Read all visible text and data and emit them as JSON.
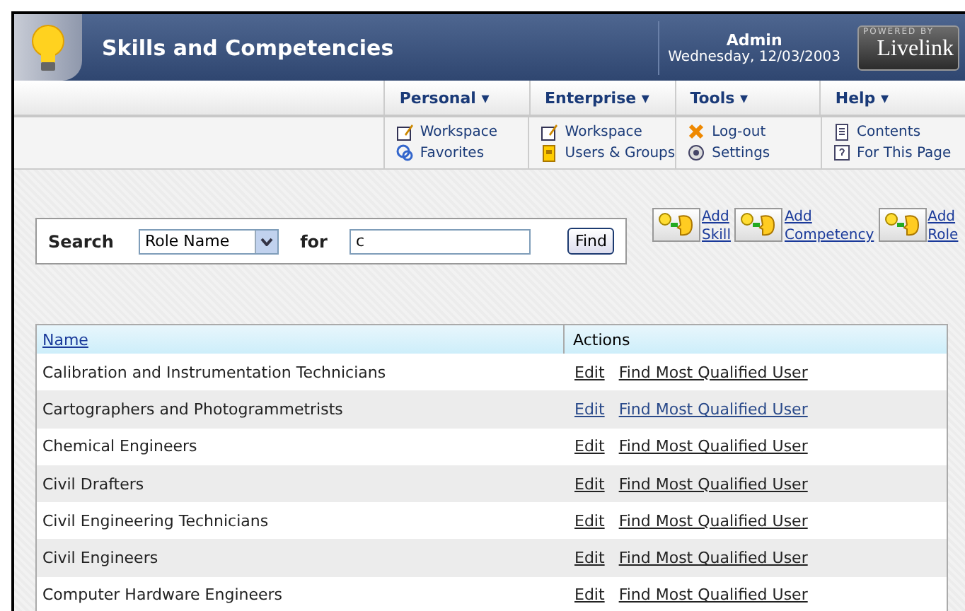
{
  "header": {
    "title": "Skills and Competencies",
    "user": "Admin",
    "date": "Wednesday, 12/03/2003",
    "logo_top": "POWERED BY",
    "logo": "Livelink"
  },
  "menus": [
    {
      "label": "Personal ▾",
      "items": [
        {
          "label": "Workspace",
          "kind": "edit"
        },
        {
          "label": "Favorites",
          "kind": "favorites"
        }
      ]
    },
    {
      "label": "Enterprise ▾",
      "items": [
        {
          "label": "Workspace",
          "kind": "edit"
        },
        {
          "label": "Users & Groups",
          "kind": "users"
        }
      ]
    },
    {
      "label": "Tools ▾",
      "items": [
        {
          "label": "Log-out",
          "kind": "logout"
        },
        {
          "label": "Settings",
          "kind": "settings"
        }
      ]
    },
    {
      "label": "Help ▾",
      "items": [
        {
          "label": "Contents",
          "kind": "contents"
        },
        {
          "label": "For This Page",
          "kind": "help"
        }
      ]
    }
  ],
  "search": {
    "label": "Search",
    "field": "Role Name",
    "for_label": "for",
    "value": "c",
    "button": "Find"
  },
  "add_actions": [
    {
      "line1": "Add",
      "line2": "Skill"
    },
    {
      "line1": "Add",
      "line2": "Competency"
    },
    {
      "line1": "Add",
      "line2": "Role"
    }
  ],
  "table": {
    "columns": [
      "Name",
      "Actions"
    ],
    "rows": [
      {
        "name": "Calibration and Instrumentation Technicians",
        "edit": "Edit",
        "find": "Find Most Qualified User",
        "visited": false
      },
      {
        "name": "Cartographers and Photogrammetrists",
        "edit": "Edit",
        "find": "Find Most Qualified User",
        "visited": true
      },
      {
        "name": "Chemical Engineers",
        "edit": "Edit",
        "find": "Find Most Qualified User",
        "visited": false
      },
      {
        "name": "Civil Drafters",
        "edit": "Edit",
        "find": "Find Most Qualified User",
        "visited": false
      },
      {
        "name": "Civil Engineering Technicians",
        "edit": "Edit",
        "find": "Find Most Qualified User",
        "visited": false
      },
      {
        "name": "Civil Engineers",
        "edit": "Edit",
        "find": "Find Most Qualified User",
        "visited": false
      },
      {
        "name": "Computer Hardware Engineers",
        "edit": "Edit",
        "find": "Find Most Qualified User",
        "visited": false
      }
    ]
  }
}
